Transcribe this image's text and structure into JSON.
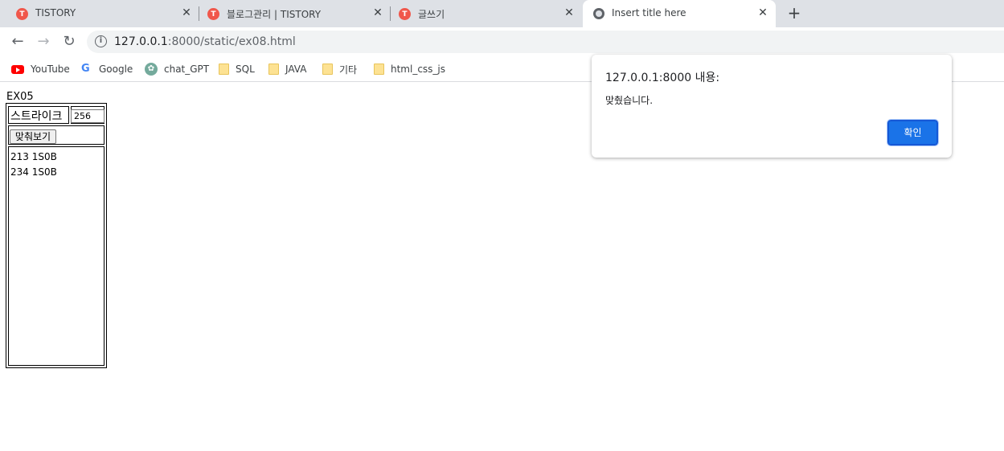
{
  "tabs": [
    {
      "title": "TISTORY",
      "favicon": "tistory-icon"
    },
    {
      "title": "블로그관리 | TISTORY",
      "favicon": "tistory-icon"
    },
    {
      "title": "글쓰기",
      "favicon": "tistory-icon"
    },
    {
      "title": "Insert title here",
      "favicon": "globe-icon",
      "active": true
    }
  ],
  "toolbar": {
    "url_host": "127.0.0.1",
    "url_rest": ":8000/static/ex08.html"
  },
  "bookmarks": [
    {
      "label": "YouTube",
      "icon": "youtube-icon"
    },
    {
      "label": "Google",
      "icon": "google-icon"
    },
    {
      "label": "chat_GPT",
      "icon": "chatgpt-icon"
    },
    {
      "label": "SQL",
      "icon": "folder-icon"
    },
    {
      "label": "JAVA",
      "icon": "folder-icon"
    },
    {
      "label": "기타",
      "icon": "folder-icon"
    },
    {
      "label": "html_css_js",
      "icon": "folder-icon"
    }
  ],
  "page": {
    "heading": "EX05",
    "strike_label": "스트라이크",
    "number_value": "256",
    "check_button": "맞춰보기",
    "results": [
      "213 1S0B",
      "234 1S0B"
    ]
  },
  "dialog": {
    "title": "127.0.0.1:8000 내용:",
    "message": "맞췄습니다.",
    "ok_label": "확인"
  },
  "colors": {
    "accent": "#1a73e8",
    "tab_strip": "#dee1e6",
    "tistory_favicon": "#f0574b"
  }
}
